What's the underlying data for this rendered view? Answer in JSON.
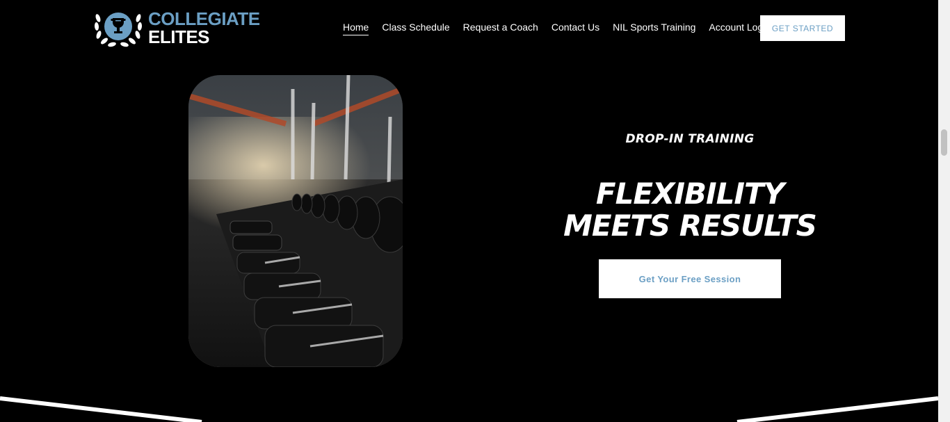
{
  "brand": {
    "line1": "COLLEGIATE",
    "line2": "ELITES",
    "accent_color": "#6b9fc4",
    "logo_icon": "trophy-laurel-icon"
  },
  "nav": {
    "items": [
      {
        "label": "Home",
        "active": true
      },
      {
        "label": "Class Schedule"
      },
      {
        "label": "Request a Coach"
      },
      {
        "label": "Contact Us"
      },
      {
        "label": "NIL Sports Training"
      },
      {
        "label": "Account Log In"
      }
    ],
    "cta_label": "GET STARTED"
  },
  "hero": {
    "image_subject": "gym dumbbell rack",
    "eyebrow": "DROP-IN TRAINING",
    "headline_line1": "FLEXIBILITY",
    "headline_line2": "MEETS RESULTS",
    "button_label": "Get Your Free Session"
  },
  "colors": {
    "background": "#000000",
    "text": "#ffffff",
    "button_bg": "#ffffff",
    "button_text": "#6b9fc4"
  }
}
